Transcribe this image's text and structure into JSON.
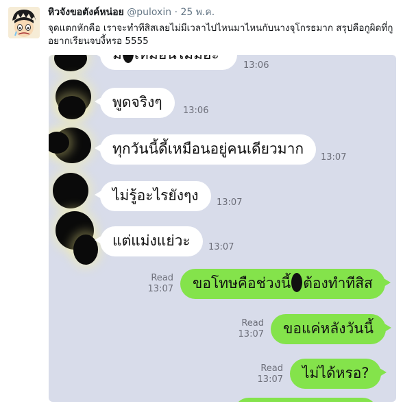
{
  "tweet": {
    "author_name": "หิวจังขอตังค์หน่อย",
    "handle": "@puloxin",
    "separator": "·",
    "date": "25 พ.ค.",
    "text": "จุดแตกหักคือ เราจะทำทีสิสเลยไม่มีเวลาไปไหนมาไหนกับนางจุโกรธมาก สรุปคือกูผิดที่กูอยากเรียนจบงี้หรอ 5555"
  },
  "chat": {
    "incoming": [
      {
        "text_start": "ม",
        "text_end": "เหมือนไม่มีอะ",
        "time": "13:06"
      },
      {
        "text": "พูดจริงๆ",
        "time": "13:06"
      },
      {
        "text": "ทุกวันนี้ดี้เหมือนอยู่คนเดียวมาก",
        "time": "13:07"
      },
      {
        "text": "ไม่รู้อะไรยังๆง",
        "time": "13:07"
      },
      {
        "text": "แต่แม่งแย่วะ",
        "time": "13:07"
      }
    ],
    "outgoing": [
      {
        "text_start": "ขอโทษคือช่วงนี้",
        "text_end": "ต้องทำทีสิส",
        "status": "Read",
        "time": "13:07"
      },
      {
        "text": "ขอแค่หลังวันนี้",
        "status": "Read",
        "time": "13:07"
      },
      {
        "text": "ไม่ได้หรอ?",
        "status": "Read",
        "time": "13:07"
      }
    ]
  },
  "colors": {
    "chat_background": "#d8dcea",
    "outgoing_bubble": "#84e34b",
    "incoming_bubble": "#ffffff"
  }
}
